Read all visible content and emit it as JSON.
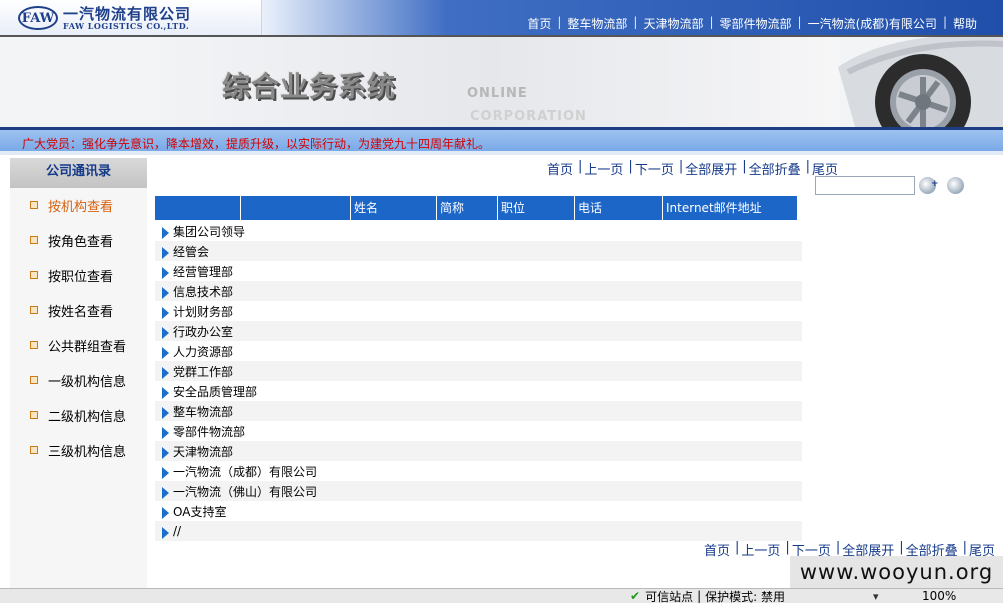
{
  "header": {
    "logo_mark": "FAW",
    "company_cn": "一汽物流有限公司",
    "company_en": "FAW LOGISTICS CO.,LTD.",
    "nav": [
      "首页",
      "整车物流部",
      "天津物流部",
      "零部件物流部",
      "一汽物流(成都)有限公司",
      "帮助"
    ]
  },
  "banner": {
    "title": "综合业务系统",
    "online": "ONLINE",
    "corp": "CORPORATION"
  },
  "notice": "广大党员：强化争先意识，降本增效，提质升级，以实际行动，为建党九十四周年献礼。",
  "sidebar": {
    "title": "公司通讯录",
    "items": [
      "按机构查看",
      "按角色查看",
      "按职位查看",
      "按姓名查看",
      "公共群组查看",
      "一级机构信息",
      "二级机构信息",
      "三级机构信息"
    ]
  },
  "pager": {
    "first": "首页",
    "prev": "上一页",
    "next": "下一页",
    "expand": "全部展开",
    "collapse": "全部折叠",
    "last": "尾页"
  },
  "search": {
    "value": "",
    "placeholder": ""
  },
  "table": {
    "columns": [
      "",
      "",
      "姓名",
      "简称",
      "职位",
      "电话",
      "Internet邮件地址"
    ],
    "rows": [
      "集团公司领导",
      "经管会",
      "经营管理部",
      "信息技术部",
      "计划财务部",
      "行政办公室",
      "人力资源部",
      "党群工作部",
      "安全品质管理部",
      "整车物流部",
      "零部件物流部",
      "天津物流部",
      "一汽物流（成都）有限公司",
      "一汽物流（佛山）有限公司",
      "OA支持室",
      "//"
    ]
  },
  "statusbar": {
    "trusted": "可信站点",
    "protected": "保护模式: 禁用",
    "zoom": "100%"
  },
  "watermark": "www.wooyun.org"
}
